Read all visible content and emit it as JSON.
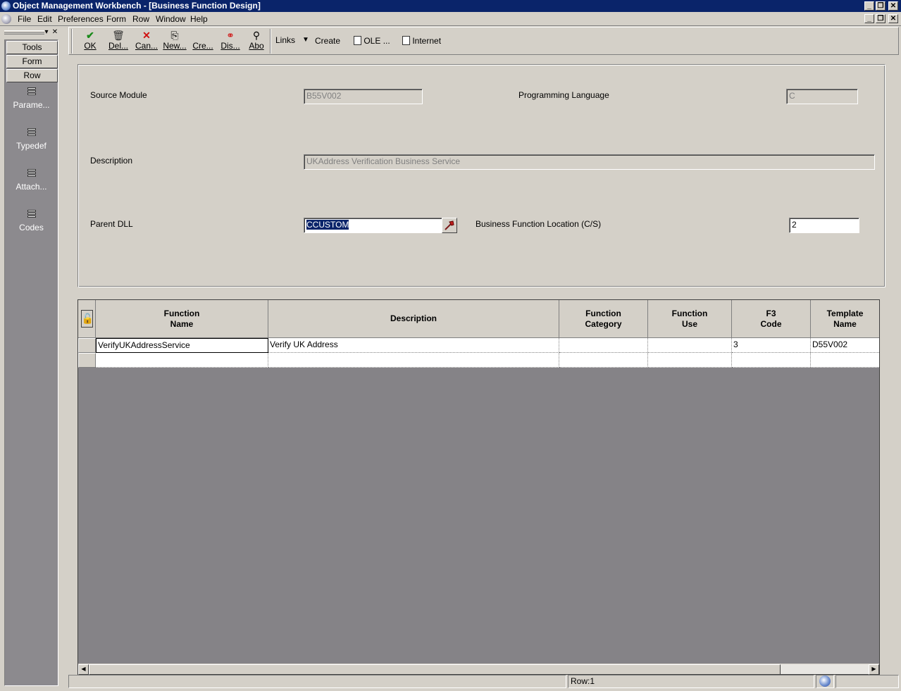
{
  "window": {
    "title": "Object Management Workbench - [Business Function Design]",
    "minimize": "_",
    "restore": "❐",
    "close": "✕"
  },
  "menu": {
    "items": [
      "File",
      "Edit",
      "Preferences",
      "Form",
      "Row",
      "Window",
      "Help"
    ]
  },
  "left_panel": {
    "tabs": [
      "Tools",
      "Form",
      "Row"
    ],
    "items": [
      "Parame...",
      "Typedef",
      "Attach...",
      "Codes"
    ]
  },
  "toolbar": {
    "buttons": [
      {
        "label": "OK",
        "icon": "check-icon"
      },
      {
        "label": "Del...",
        "icon": "trash-icon"
      },
      {
        "label": "Can...",
        "icon": "x-icon"
      },
      {
        "label": "New...",
        "icon": "new-icon"
      },
      {
        "label": "Cre...",
        "icon": "create-icon"
      },
      {
        "label": "Dis...",
        "icon": "display-icon"
      },
      {
        "label": "Abo",
        "icon": "about-icon"
      }
    ],
    "links_label": "Links",
    "create_label": "Create",
    "ole_label": "OLE ...",
    "internet_label": "Internet"
  },
  "form": {
    "source_module_label": "Source Module",
    "source_module_value": "B55V002",
    "programming_language_label": "Programming Language",
    "programming_language_value": "C",
    "description_label": "Description",
    "description_value": "UKAddress Verification Business Service",
    "parent_dll_label": "Parent DLL",
    "parent_dll_value": "CCUSTOM",
    "bf_location_label": "Business Function Location (C/S)",
    "bf_location_value": "2"
  },
  "grid": {
    "headers": [
      [
        "Function",
        "Name"
      ],
      [
        "Description"
      ],
      [
        "Function",
        "Category"
      ],
      [
        "Function",
        "Use"
      ],
      [
        "F3",
        "Code"
      ],
      [
        "Template",
        "Name"
      ]
    ],
    "rows": [
      [
        "VerifyUKAddressService",
        "Verify UK Address",
        "",
        "",
        "3",
        "D55V002"
      ],
      [
        "",
        "",
        "",
        "",
        "",
        ""
      ]
    ]
  },
  "status": {
    "row_text": "Row:1"
  }
}
